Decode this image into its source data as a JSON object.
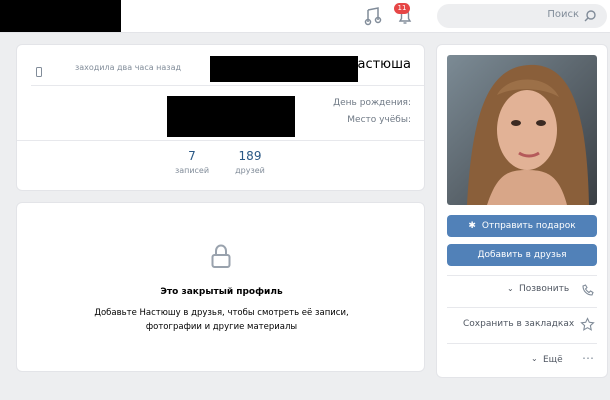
{
  "search": {
    "label": "Поиск"
  },
  "header": {
    "notifications_count": "11"
  },
  "profile": {
    "name": "Настюша",
    "last_seen": "заходила два часа назад",
    "fields": [
      {
        "label": "День рождения:"
      },
      {
        "label": "Место учёбы:"
      }
    ],
    "counters": [
      {
        "value": "189",
        "label": "друзей"
      },
      {
        "value": "7",
        "label": "записей"
      }
    ]
  },
  "closed_profile": {
    "title": "Это закрытый профиль",
    "text_line1": "Добавьте Настюшу в друзья, чтобы смотреть её записи,",
    "text_line2": "фотографии и другие материалы"
  },
  "sidebar": {
    "gift_button": "Отправить подарок",
    "add_friend_button": "Добавить в друзья",
    "call_label": "Позвонить",
    "bookmark_label": "Сохранить в закладках",
    "more_label": "Ещё"
  },
  "colors": {
    "accent": "#5181b8",
    "badge": "#e64646",
    "page_bg": "#edeef0"
  }
}
